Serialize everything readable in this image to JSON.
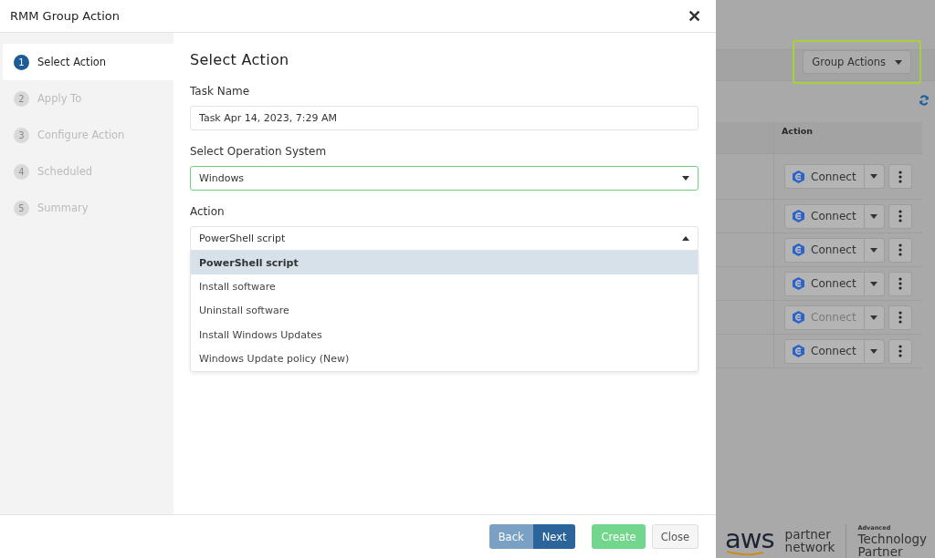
{
  "modal": {
    "title": "RMM Group Action",
    "close": "✕",
    "steps": [
      {
        "number": "1",
        "label": "Select Action",
        "selected": true
      },
      {
        "number": "2",
        "label": "Apply To",
        "selected": false
      },
      {
        "number": "3",
        "label": "Configure Action",
        "selected": false
      },
      {
        "number": "4",
        "label": "Scheduled",
        "selected": false
      },
      {
        "number": "5",
        "label": "Summary",
        "selected": false
      }
    ],
    "heading": "Select Action",
    "fields": [
      {
        "kind": "text",
        "label": "Task Name",
        "value": "Task Apr 14, 2023, 7:29 AM"
      },
      {
        "kind": "select",
        "label": "Select Operation System",
        "value": "Windows",
        "focused": true,
        "expanded": false
      },
      {
        "kind": "select",
        "label": "Action",
        "value": "PowerShell script",
        "focused": false,
        "expanded": true,
        "options": [
          {
            "label": "PowerShell script",
            "selected": true
          },
          {
            "label": "Install software",
            "selected": false
          },
          {
            "label": "Uninstall software",
            "selected": false
          },
          {
            "label": "Install Windows Updates",
            "selected": false
          },
          {
            "label": "Windows Update policy (New)",
            "selected": false
          }
        ]
      }
    ],
    "buttons": [
      {
        "label": "Back",
        "kind": "back"
      },
      {
        "label": "Next",
        "kind": "next"
      },
      {
        "label": "Create",
        "kind": "create"
      },
      {
        "label": "Close",
        "kind": "close"
      }
    ]
  },
  "page": {
    "group_actions": "Group Actions",
    "highlighted": true,
    "table": {
      "columns": [
        "Action"
      ],
      "rows": [
        {
          "action": "Connect",
          "disabled": false
        },
        {
          "action": "Connect",
          "disabled": false
        },
        {
          "action": "Connect",
          "disabled": false
        },
        {
          "action": "Connect",
          "disabled": false
        },
        {
          "action": "Connect",
          "disabled": true
        },
        {
          "action": "Connect",
          "disabled": false
        }
      ]
    },
    "partner_logo": {
      "brand": "aws",
      "line_1": "partner",
      "line_2": "network",
      "tier": "Advanced",
      "level_1": "Technology",
      "level_2": "Partner"
    }
  }
}
